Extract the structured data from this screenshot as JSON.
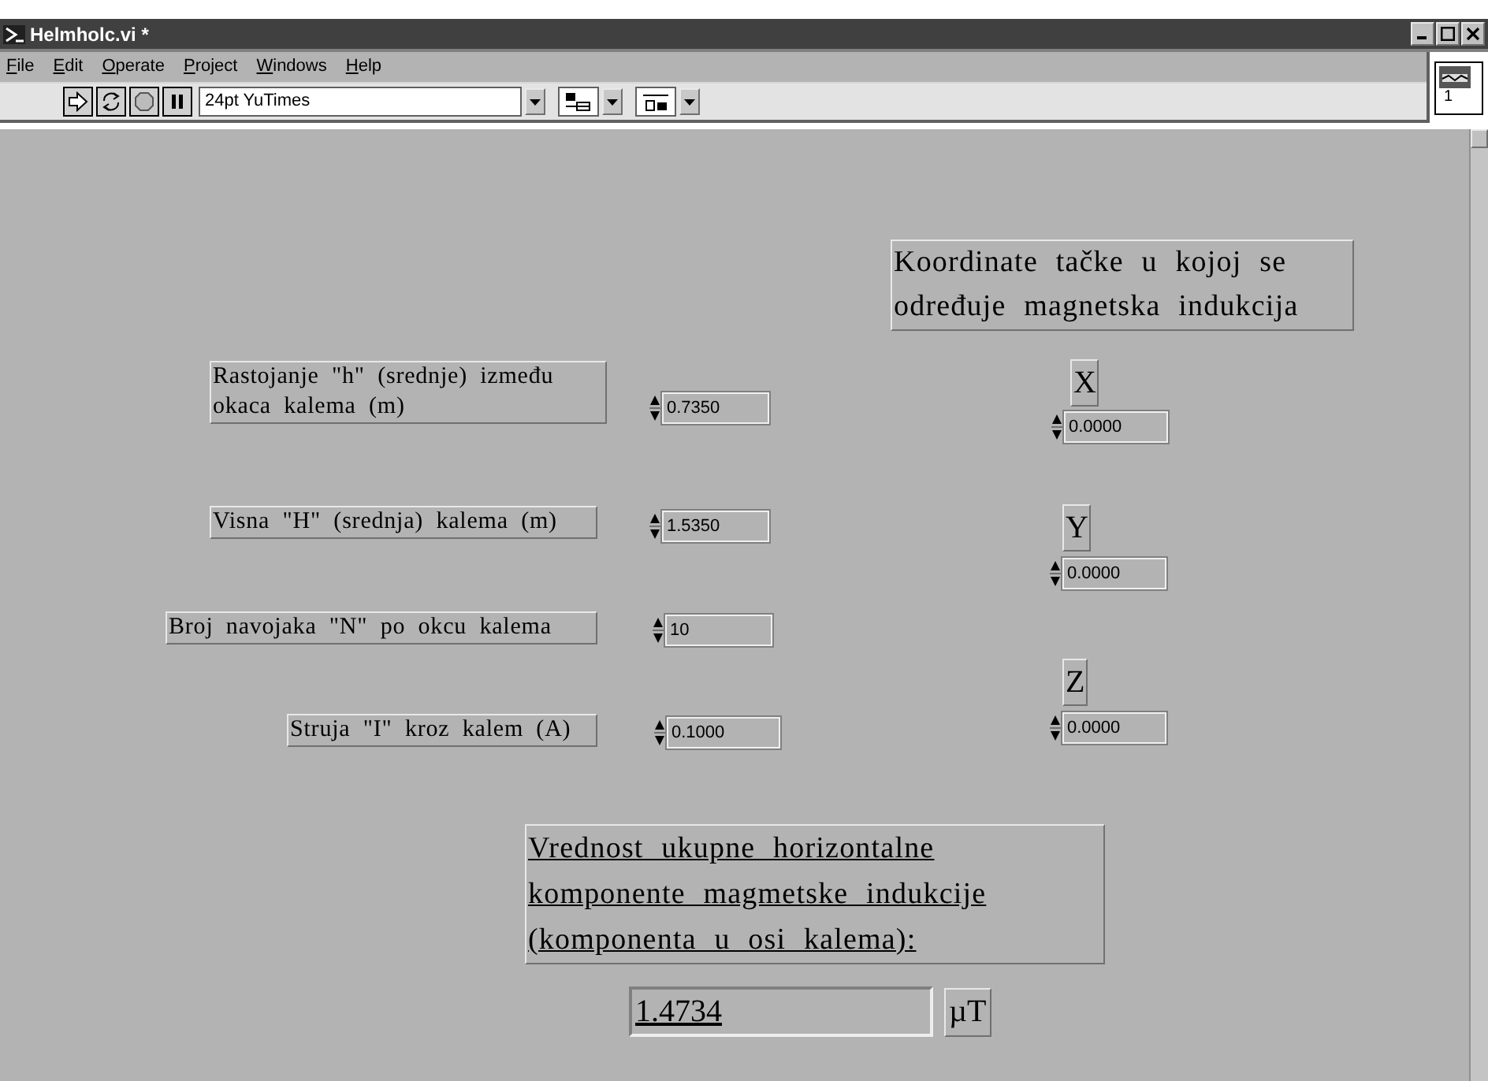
{
  "window": {
    "title": "Helmholc.vi *"
  },
  "menu": [
    "File",
    "Edit",
    "Operate",
    "Project",
    "Windows",
    "Help"
  ],
  "toolbar": {
    "font": "24pt YuTimes"
  },
  "vi_icon": {
    "number": "1"
  },
  "inputs": [
    {
      "label": "Rastojanje \"h\" (srednje) između okaca kalema (m)",
      "value": "0.7350"
    },
    {
      "label": "Visna \"H\" (srednja) kalema (m)",
      "value": "1.5350"
    },
    {
      "label": "Broj navojaka \"N\" po okcu kalema",
      "value": "10"
    },
    {
      "label": "Struja \"I\" kroz kalem (A)",
      "value": "0.1000"
    }
  ],
  "coordinates": {
    "title": "Koordinate tačke u kojoj se određuje magnetska indukcija",
    "axes": [
      {
        "label": "X",
        "value": "0.0000"
      },
      {
        "label": "Y",
        "value": "0.0000"
      },
      {
        "label": "Z",
        "value": "0.0000"
      }
    ]
  },
  "result": {
    "title": "Vrednost ukupne horizontalne komponente magmetske indukcije (komponenta u osi kalema):",
    "value": "1.4734",
    "unit": "µT"
  }
}
